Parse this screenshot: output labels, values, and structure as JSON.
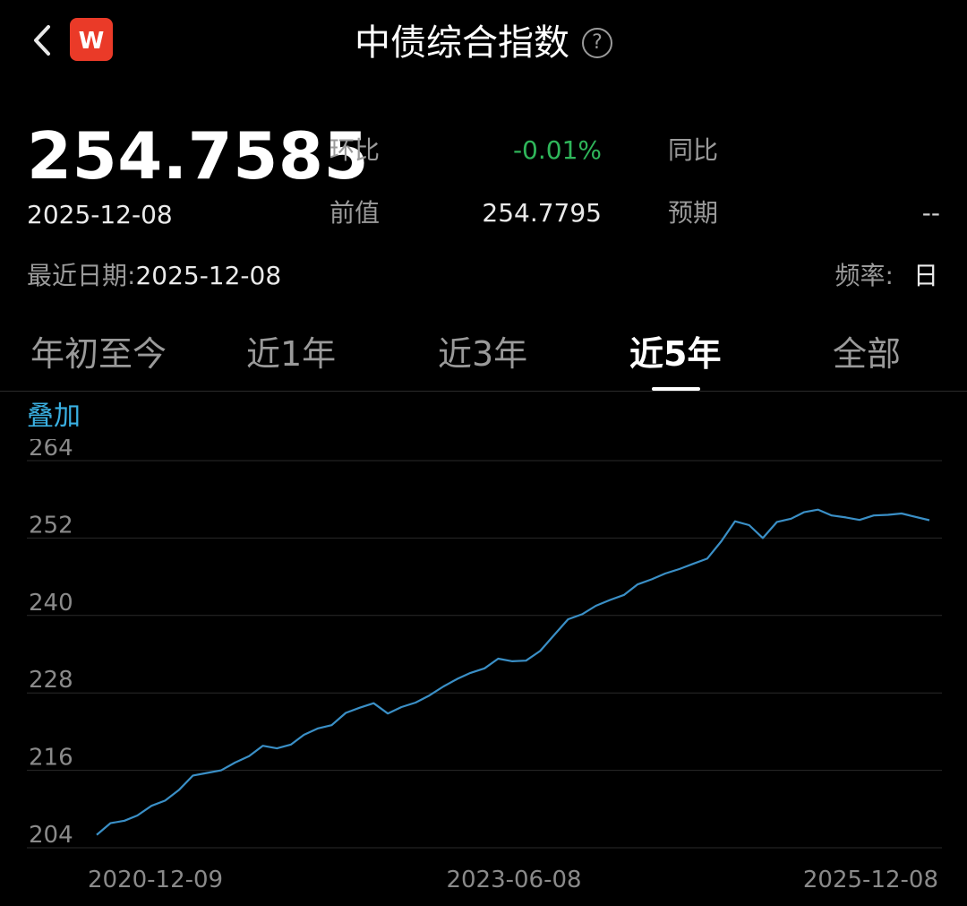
{
  "header": {
    "title": "中债综合指数",
    "back_icon": "chevron-left-icon",
    "app_logo_text": "W",
    "app_logo_color": "#ea3a28",
    "help_icon": "question-circle-icon",
    "help_glyph": "?"
  },
  "summary": {
    "value": "254.7585",
    "date": "2025-12-08",
    "mom_label": "环比",
    "mom_value": "-0.01%",
    "yoy_label": "同比",
    "prev_label": "前值",
    "prev_value": "254.7795",
    "expected_label": "预期",
    "expected_value": "--",
    "recent_label": "最近日期:",
    "recent_value": "2025-12-08",
    "freq_label": "频率:",
    "freq_value": "日",
    "down_color": "#2fb65a"
  },
  "tabs": [
    {
      "label": "年初至今",
      "active": false
    },
    {
      "label": "近1年",
      "active": false
    },
    {
      "label": "近3年",
      "active": false
    },
    {
      "label": "近5年",
      "active": true
    },
    {
      "label": "全部",
      "active": false
    }
  ],
  "overlay_label": "叠加",
  "colors": {
    "background": "#000000",
    "accent": "#3ab0e2",
    "line": "#3a8fc6",
    "grid": "#2a2a2a"
  },
  "chart_data": {
    "type": "line",
    "title": "",
    "xlabel": "",
    "ylabel": "",
    "ylim": [
      204,
      264
    ],
    "yticks": [
      264,
      252,
      240,
      228,
      216,
      204
    ],
    "x_tick_labels": [
      "2020-12-09",
      "2023-06-08",
      "2025-12-08"
    ],
    "grid": true,
    "series": [
      {
        "x": [
          "2020-12-09",
          "2021-01-08",
          "2021-02-08",
          "2021-03-08",
          "2021-04-08",
          "2021-05-08",
          "2021-06-08",
          "2021-07-08",
          "2021-08-08",
          "2021-09-08",
          "2021-10-08",
          "2021-11-08",
          "2021-12-08",
          "2022-01-08",
          "2022-02-08",
          "2022-03-08",
          "2022-04-08",
          "2022-05-08",
          "2022-06-08",
          "2022-07-08",
          "2022-08-08",
          "2022-09-08",
          "2022-10-08",
          "2022-11-08",
          "2022-12-08",
          "2023-01-08",
          "2023-02-08",
          "2023-03-08",
          "2023-04-08",
          "2023-05-08",
          "2023-06-08",
          "2023-07-08",
          "2023-08-08",
          "2023-09-08",
          "2023-10-08",
          "2023-11-08",
          "2023-12-08",
          "2024-01-08",
          "2024-02-08",
          "2024-03-08",
          "2024-04-08",
          "2024-05-08",
          "2024-06-08",
          "2024-07-08",
          "2024-08-08",
          "2024-09-08",
          "2024-10-08",
          "2024-11-08",
          "2024-12-08",
          "2025-01-08",
          "2025-02-08",
          "2025-03-08",
          "2025-04-08",
          "2025-05-08",
          "2025-06-08",
          "2025-07-08",
          "2025-08-08",
          "2025-09-08",
          "2025-10-08",
          "2025-12-08"
        ],
        "values": [
          206.0,
          207.8,
          208.2,
          209.0,
          210.5,
          211.3,
          213.0,
          215.2,
          215.6,
          216.0,
          217.2,
          218.2,
          219.8,
          219.4,
          220.0,
          221.5,
          222.5,
          223.0,
          224.9,
          225.7,
          226.4,
          224.8,
          225.8,
          226.5,
          227.6,
          229.0,
          230.2,
          231.1,
          231.8,
          233.3,
          232.9,
          233.0,
          234.5,
          237.0,
          239.4,
          240.2,
          241.5,
          242.4,
          243.2,
          244.8,
          245.6,
          246.5,
          247.2,
          248.0,
          248.8,
          251.5,
          254.6,
          254.0,
          252.0,
          254.5,
          255.0,
          256.0,
          256.4,
          255.5,
          255.2,
          254.8,
          255.5,
          255.6,
          255.8,
          254.76
        ]
      }
    ]
  }
}
